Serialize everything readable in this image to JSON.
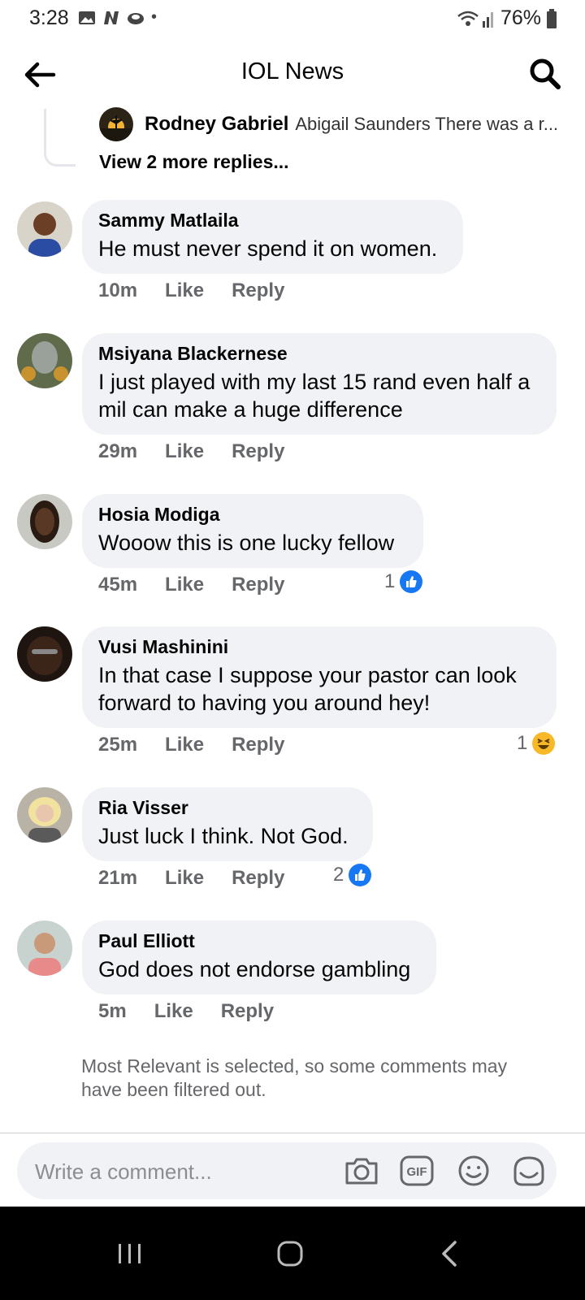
{
  "status_bar": {
    "time": "3:28",
    "battery": "76%",
    "dot": "•"
  },
  "header": {
    "title": "IOL News"
  },
  "thread": {
    "reply_author": "Rodney Gabriel",
    "reply_preview": "Abigail Saunders There was a r...",
    "view_more": "View 2 more replies..."
  },
  "comments": [
    {
      "author": "Sammy Matlaila",
      "text": "He must never spend it on women.",
      "time": "10m",
      "like": "Like",
      "reply": "Reply",
      "reaction_count": "",
      "reaction": ""
    },
    {
      "author": "Msiyana Blackernese",
      "text": "I just played with my last 15 rand even half a mil can make a huge difference",
      "time": "29m",
      "like": "Like",
      "reply": "Reply",
      "reaction_count": "",
      "reaction": ""
    },
    {
      "author": "Hosia Modiga",
      "text": "Wooow this is one lucky fellow",
      "time": "45m",
      "like": "Like",
      "reply": "Reply",
      "reaction_count": "1",
      "reaction": "like-icon"
    },
    {
      "author": "Vusi Mashinini",
      "text": "In that case I suppose your pastor can look forward to having you around hey!",
      "time": "25m",
      "like": "Like",
      "reply": "Reply",
      "reaction_count": "1",
      "reaction": "haha-icon"
    },
    {
      "author": "Ria Visser",
      "text": "Just luck I think. Not God.",
      "time": "21m",
      "like": "Like",
      "reply": "Reply",
      "reaction_count": "2",
      "reaction": "like-icon"
    },
    {
      "author": "Paul Elliott",
      "text": "God does not endorse gambling",
      "time": "5m",
      "like": "Like",
      "reply": "Reply",
      "reaction_count": "",
      "reaction": ""
    }
  ],
  "filter_note": "Most Relevant is selected, so some comments may have been filtered out.",
  "composer": {
    "placeholder": "Write a comment..."
  },
  "colors": {
    "accent": "#1877f2",
    "bubble": "#f0f2f5",
    "muted": "#65676b",
    "haha": "#f7b928"
  }
}
